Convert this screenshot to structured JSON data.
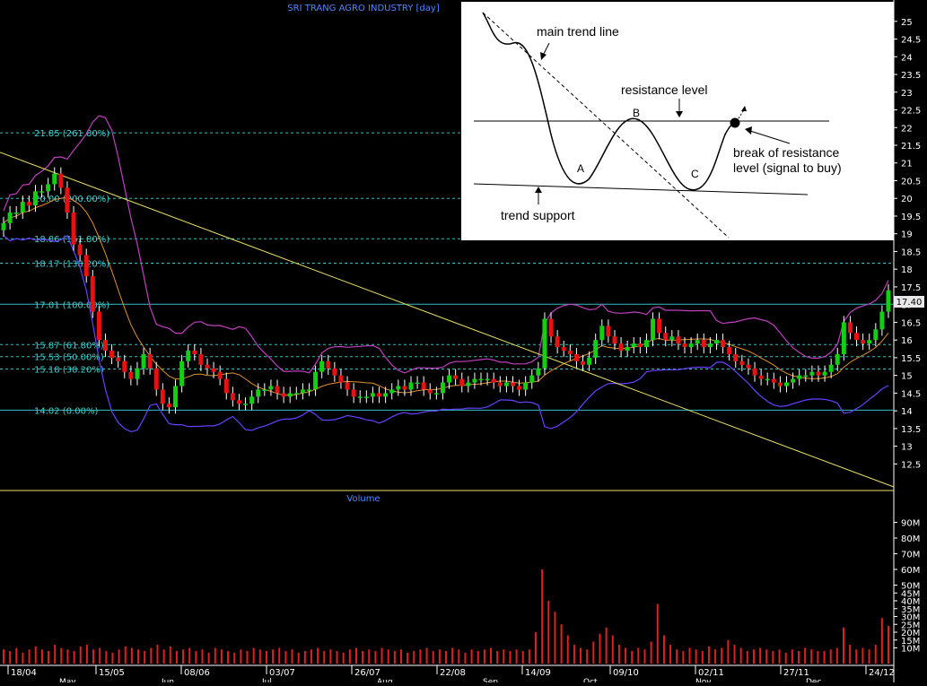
{
  "chart_data": {
    "type": "candlestick",
    "title": "SRI TRANG AGRO INDUSTRY [day]",
    "last_price_label": "17.40",
    "price_axis": {
      "ylim": [
        11.8,
        25.4
      ],
      "ticks": [
        "12.5",
        "13",
        "13.5",
        "14",
        "14.5",
        "15",
        "15.5",
        "16",
        "16.5",
        "17",
        "17.5",
        "18",
        "18.5",
        "19",
        "19.5",
        "20",
        "20.5",
        "21",
        "21.5",
        "22",
        "22.5",
        "23",
        "23.5",
        "24",
        "24.5",
        "25"
      ]
    },
    "volume_panel_label": "Volume",
    "volume_axis": {
      "ylim": [
        0,
        100
      ],
      "unit": "M",
      "ticks": [
        "10M",
        "15M",
        "20M",
        "25M",
        "30M",
        "35M",
        "40M",
        "45M",
        "50M",
        "60M",
        "70M",
        "80M",
        "90M"
      ]
    },
    "date_labels": [
      "18/04",
      "15/05",
      "08/06",
      "03/07",
      "26/07",
      "22/08",
      "14/09",
      "09/10",
      "02/11",
      "27/11",
      "24/12"
    ],
    "month_labels": [
      "May",
      "Jun",
      "Jul",
      "Aug",
      "Sep",
      "Oct",
      "Nov",
      "Dec"
    ],
    "fibonacci_levels": [
      {
        "price": 21.85,
        "label": "21.85 (261.80%)"
      },
      {
        "price": 20.0,
        "label": "20.00 (200.00%)"
      },
      {
        "price": 18.86,
        "label": "18.86 (161.80%)"
      },
      {
        "price": 18.17,
        "label": "18.17 (138.20%)"
      },
      {
        "price": 17.01,
        "label": "17.01 (100.00%)"
      },
      {
        "price": 15.87,
        "label": "15.87 (61.80%)"
      },
      {
        "price": 15.53,
        "label": "15.53 (50.00%)"
      },
      {
        "price": 15.18,
        "label": "15.18 (38.20%)"
      },
      {
        "price": 14.02,
        "label": "14.02 (0.00%)"
      }
    ],
    "trend_line": {
      "from": {
        "date": "start",
        "price": 21.3
      },
      "to": {
        "date": "24/12",
        "price": 11.85
      }
    },
    "series": [
      {
        "type": "candles",
        "closes": [
          19.3,
          19.6,
          19.6,
          19.9,
          19.8,
          20.2,
          20.2,
          20.4,
          20.7,
          20.3,
          19.6,
          18.7,
          18.4,
          17.8,
          16.8,
          16.0,
          15.7,
          15.5,
          15.4,
          15.1,
          14.9,
          15.2,
          15.6,
          15.2,
          14.6,
          14.2,
          14.1,
          14.7,
          15.4,
          15.7,
          15.6,
          15.3,
          15.2,
          15.1,
          14.9,
          14.5,
          14.3,
          14.2,
          14.2,
          14.4,
          14.6,
          14.6,
          14.7,
          14.5,
          14.4,
          14.5,
          14.5,
          14.6,
          14.6,
          15.1,
          15.4,
          15.2,
          15.0,
          14.8,
          14.6,
          14.4,
          14.4,
          14.4,
          14.5,
          14.4,
          14.5,
          14.6,
          14.7,
          14.6,
          14.8,
          14.8,
          14.6,
          14.5,
          14.5,
          14.8,
          15.0,
          14.9,
          14.7,
          14.8,
          14.9,
          14.9,
          14.9,
          14.8,
          14.7,
          14.8,
          14.7,
          14.6,
          14.8,
          15.0,
          15.2,
          16.6,
          16.1,
          15.8,
          15.7,
          15.6,
          15.4,
          15.3,
          15.5,
          16.0,
          16.4,
          16.1,
          15.9,
          15.7,
          15.8,
          15.9,
          15.8,
          16.0,
          16.6,
          16.2,
          16.0,
          16.1,
          15.9,
          15.8,
          15.9,
          16.0,
          15.8,
          15.9,
          16.0,
          15.8,
          15.6,
          15.4,
          15.3,
          15.2,
          15.0,
          14.9,
          14.9,
          14.8,
          14.7,
          14.8,
          14.9,
          15.0,
          15.0,
          15.1,
          15.0,
          15.1,
          15.3,
          15.6,
          16.5,
          16.2,
          16.0,
          15.9,
          16.0,
          16.3,
          16.8,
          17.4
        ]
      }
    ],
    "bollinger_color": "#c040c0",
    "lower_band_color": "#6a40ff",
    "ma_color": "#e09030",
    "volumes": [
      9,
      8,
      10,
      7,
      9,
      11,
      9,
      8,
      12,
      10,
      9,
      8,
      11,
      12,
      9,
      10,
      8,
      7,
      9,
      11,
      10,
      9,
      8,
      10,
      12,
      9,
      11,
      8,
      9,
      10,
      8,
      9,
      7,
      10,
      9,
      8,
      7,
      9,
      8,
      10,
      9,
      8,
      9,
      10,
      8,
      9,
      7,
      8,
      9,
      10,
      8,
      9,
      8,
      7,
      9,
      10,
      8,
      9,
      8,
      10,
      9,
      8,
      9,
      7,
      8,
      9,
      10,
      8,
      9,
      8,
      10,
      9,
      7,
      9,
      8,
      9,
      10,
      8,
      9,
      8,
      9,
      8,
      9,
      20,
      60,
      40,
      33,
      25,
      18,
      12,
      10,
      9,
      14,
      19,
      23,
      18,
      12,
      10,
      8,
      10,
      9,
      14,
      38,
      18,
      12,
      9,
      8,
      10,
      9,
      8,
      11,
      9,
      10,
      15,
      12,
      10,
      8,
      9,
      10,
      9,
      8,
      9,
      7,
      9,
      8,
      10,
      9,
      8,
      8,
      9,
      10,
      23,
      12,
      9,
      10,
      9,
      12,
      29,
      24
    ],
    "colors": {
      "up": "#10d010",
      "down": "#e81010",
      "fib_line": "#30c0c0",
      "fib_text": "#40d0d0",
      "trend": "#e8e060",
      "axis_text": "#ffffff",
      "title": "#4f86ff",
      "vol_bar": "#e02020",
      "last_price_bg": "#e8e8e8"
    }
  },
  "inset": {
    "main_trend_line": "main trend line",
    "resistance_level": "resistance level",
    "point_a": "A",
    "point_b": "B",
    "point_c": "C",
    "break_line1": "break of resistance",
    "break_line2": "level (signal to buy)",
    "trend_support": "trend support"
  }
}
